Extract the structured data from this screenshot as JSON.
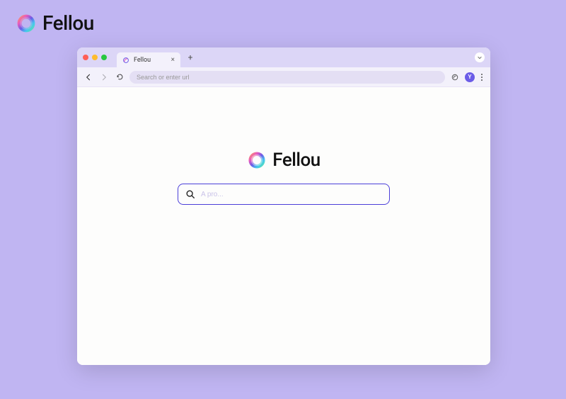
{
  "outer_brand": {
    "name": "Fellou"
  },
  "browser": {
    "tab": {
      "title": "Fellou"
    },
    "toolbar": {
      "address_placeholder": "Search or enter url",
      "avatar_initial": "Y"
    }
  },
  "page": {
    "brand_name": "Fellou",
    "search_placeholder": "A pro..."
  },
  "colors": {
    "bg": "#C0B5F2",
    "accent": "#4B3FD9",
    "avatar": "#6B5CE7"
  }
}
